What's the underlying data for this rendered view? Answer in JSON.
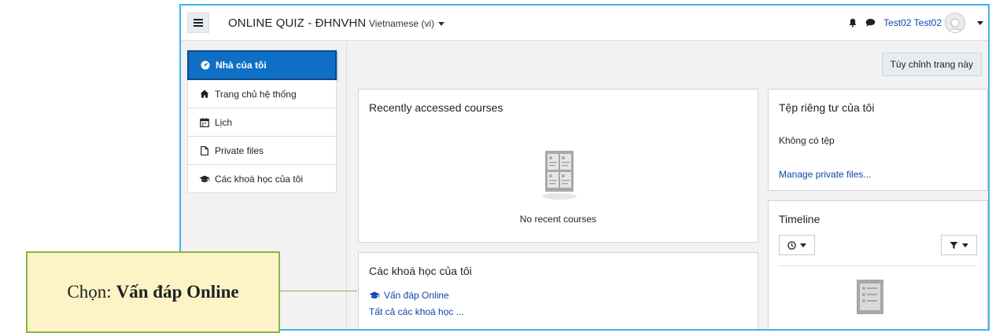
{
  "navbar": {
    "site_title": "ONLINE QUIZ - ĐHNVHN",
    "language": "Vietnamese (vi)",
    "user_name": "Test02 Test02"
  },
  "sidebar": {
    "items": [
      {
        "label": "Nhà của tôi",
        "icon": "dashboard-icon",
        "active": true
      },
      {
        "label": "Trang chủ hệ thống",
        "icon": "home-icon"
      },
      {
        "label": "Lịch",
        "icon": "calendar-icon"
      },
      {
        "label": "Private files",
        "icon": "file-icon"
      },
      {
        "label": "Các khoá học của tôi",
        "icon": "graduation-cap-icon"
      }
    ]
  },
  "main": {
    "customize_button": "Tùy chỉnh trang này",
    "recent_courses": {
      "title": "Recently accessed courses",
      "empty_text": "No recent courses"
    },
    "my_courses": {
      "title": "Các khoá học của tôi",
      "course_link": "Vấn đáp Online",
      "all_courses_link": "Tất cả các khoá học ..."
    },
    "private_files": {
      "title": "Tệp riêng tư của tôi",
      "empty_text": "Không có tệp",
      "manage_link": "Manage private files..."
    },
    "timeline": {
      "title": "Timeline"
    }
  },
  "callout": {
    "prefix": "Chọn:",
    "highlight": "Vấn đáp Online"
  },
  "colors": {
    "active_nav": "#0f6fc5",
    "link": "#0f47ad",
    "frame_border": "#3fb3e6",
    "callout_bg": "#fdf3c6",
    "callout_border": "#8db347"
  }
}
